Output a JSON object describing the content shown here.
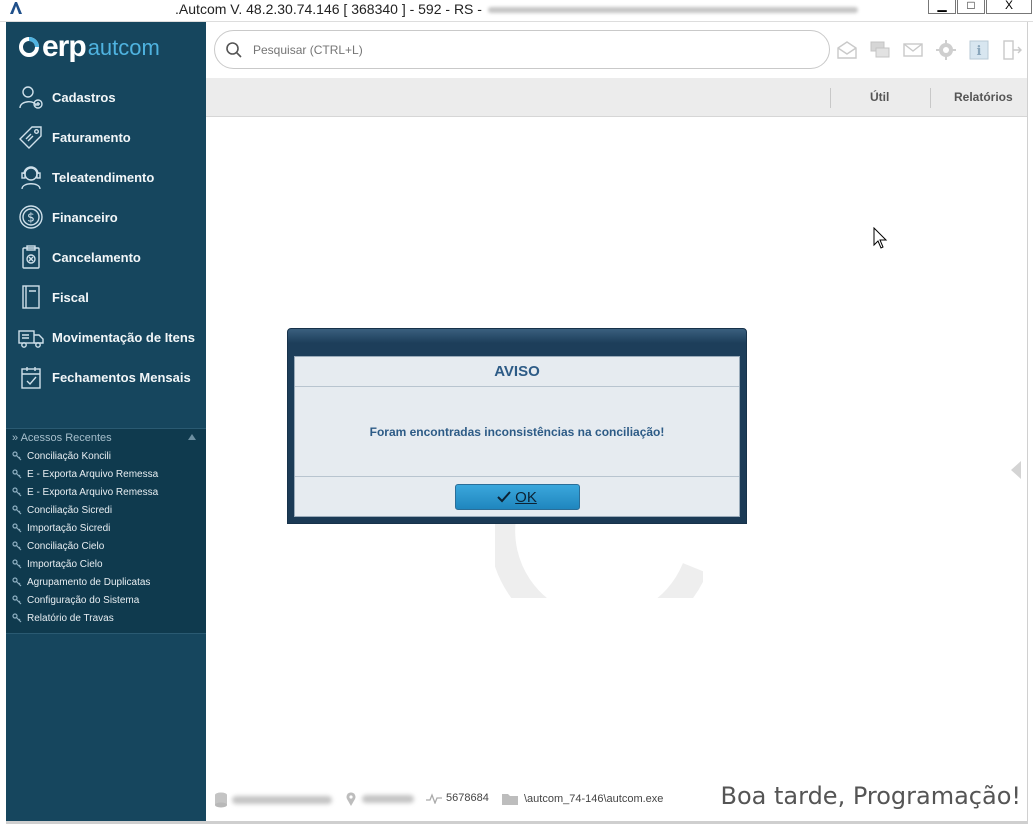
{
  "window": {
    "title": ".Autcom V. 48.2.30.74.146 [ 368340 ] - 592 - RS -",
    "minimize": "▁",
    "maximize": "□",
    "close": "X"
  },
  "logo": {
    "erp": "erp",
    "brand": "autcom"
  },
  "sidebar": {
    "items": [
      {
        "label": "Cadastros",
        "icon": "user-add-icon"
      },
      {
        "label": "Faturamento",
        "icon": "tag-icon"
      },
      {
        "label": "Teleatendimento",
        "icon": "headset-icon"
      },
      {
        "label": "Financeiro",
        "icon": "dollar-icon"
      },
      {
        "label": "Cancelamento",
        "icon": "clipboard-cancel-icon"
      },
      {
        "label": "Fiscal",
        "icon": "notebook-icon"
      },
      {
        "label": "Movimentação de Itens",
        "icon": "truck-icon"
      },
      {
        "label": "Fechamentos Mensais",
        "icon": "calendar-check-icon"
      }
    ],
    "recent": {
      "title": "» Acessos Recentes",
      "items": [
        "Conciliação Koncili",
        "E - Exporta Arquivo Remessa",
        "E - Exporta Arquivo Remessa",
        "Conciliação Sicredi",
        "Importação Sicredi",
        "Conciliação Cielo",
        "Importação Cielo",
        "Agrupamento de Duplicatas",
        "Configuração do Sistema",
        "Relatório de Travas"
      ]
    }
  },
  "search": {
    "placeholder": "Pesquisar (CTRL+L)",
    "value": ""
  },
  "toolbar": {
    "icons": [
      "mail-open-icon",
      "chat-icon",
      "envelope-icon",
      "gear-icon",
      "info-icon",
      "exit-icon"
    ]
  },
  "tabs": {
    "util": "Útil",
    "relatorios": "Relatórios"
  },
  "dialog": {
    "title": "AVISO",
    "message": "Foram encontradas inconsistências na conciliação!",
    "ok_label": "OK"
  },
  "status": {
    "code": "5678684",
    "path": "\\autcom_74-146\\autcom.exe",
    "greeting": "Boa tarde, Programação!"
  },
  "colors": {
    "sidebar": "#16465e",
    "recent_panel": "#0f3a4e",
    "accent": "#4fb3e0",
    "dialog_text": "#2d5b86",
    "ok_button": "#2a95cc"
  }
}
